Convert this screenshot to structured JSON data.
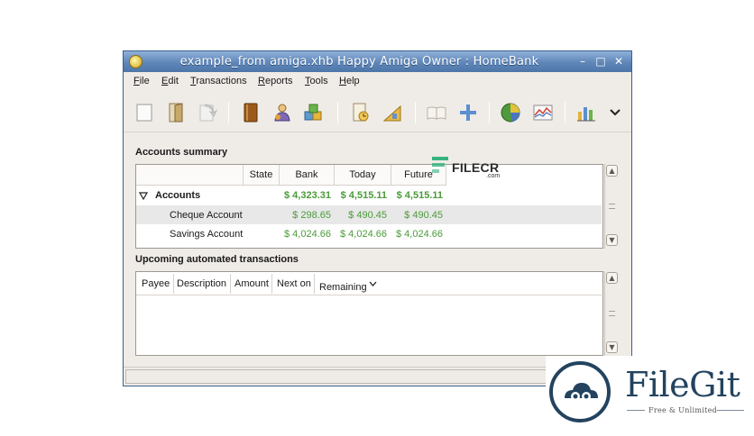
{
  "window": {
    "title": "example_from amiga.xhb Happy Amiga Owner : HomeBank",
    "controls": [
      "–",
      "□",
      "✕"
    ]
  },
  "menubar": [
    {
      "label": "File",
      "mnemonic": "F",
      "rest": "ile"
    },
    {
      "label": "Edit",
      "mnemonic": "E",
      "rest": "dit"
    },
    {
      "label": "Transactions",
      "mnemonic": "T",
      "rest": "ransactions"
    },
    {
      "label": "Reports",
      "mnemonic": "R",
      "rest": "eports"
    },
    {
      "label": "Tools",
      "mnemonic": "T",
      "rest": "ools"
    },
    {
      "label": "Help",
      "mnemonic": "H",
      "rest": "elp"
    }
  ],
  "toolbar": {
    "icons": [
      "new-file-icon",
      "open-file-icon",
      "save-file-icon",
      "accounts-book-icon",
      "payees-icon",
      "categories-puzzle-icon",
      "scheduled-transactions-icon",
      "budget-icon",
      "show-transactions-icon",
      "add-transaction-icon",
      "statistics-pie-icon",
      "balance-report-icon",
      "budget-chart-icon",
      "more-chevron-icon"
    ]
  },
  "accounts_summary": {
    "title": "Accounts summary",
    "columns": [
      "",
      "State",
      "Bank",
      "Today",
      "Future"
    ],
    "group": {
      "label": "Accounts",
      "bank": "$ 4,323.31",
      "today": "$ 4,515.11",
      "future": "$ 4,515.11"
    },
    "rows": [
      {
        "name": "Cheque Account",
        "bank": "$ 298.65",
        "today": "$ 490.45",
        "future": "$ 490.45"
      },
      {
        "name": "Savings Account",
        "bank": "$ 4,024.66",
        "today": "$ 4,024.66",
        "future": "$ 4,024.66"
      }
    ]
  },
  "upcoming": {
    "title": "Upcoming automated transactions",
    "columns": [
      "Payee",
      "Description",
      "Amount",
      "Next on",
      "Remaining"
    ]
  },
  "watermarks": {
    "filecr": "FILECR",
    "filecr_domain": ".com",
    "filegit": "FileGit",
    "filegit_tagline": "Free & Unlimited"
  },
  "colors": {
    "amount_green": "#4a9a38",
    "titlebar_blue": "#5f86b8",
    "filegit_navy": "#23435f"
  }
}
